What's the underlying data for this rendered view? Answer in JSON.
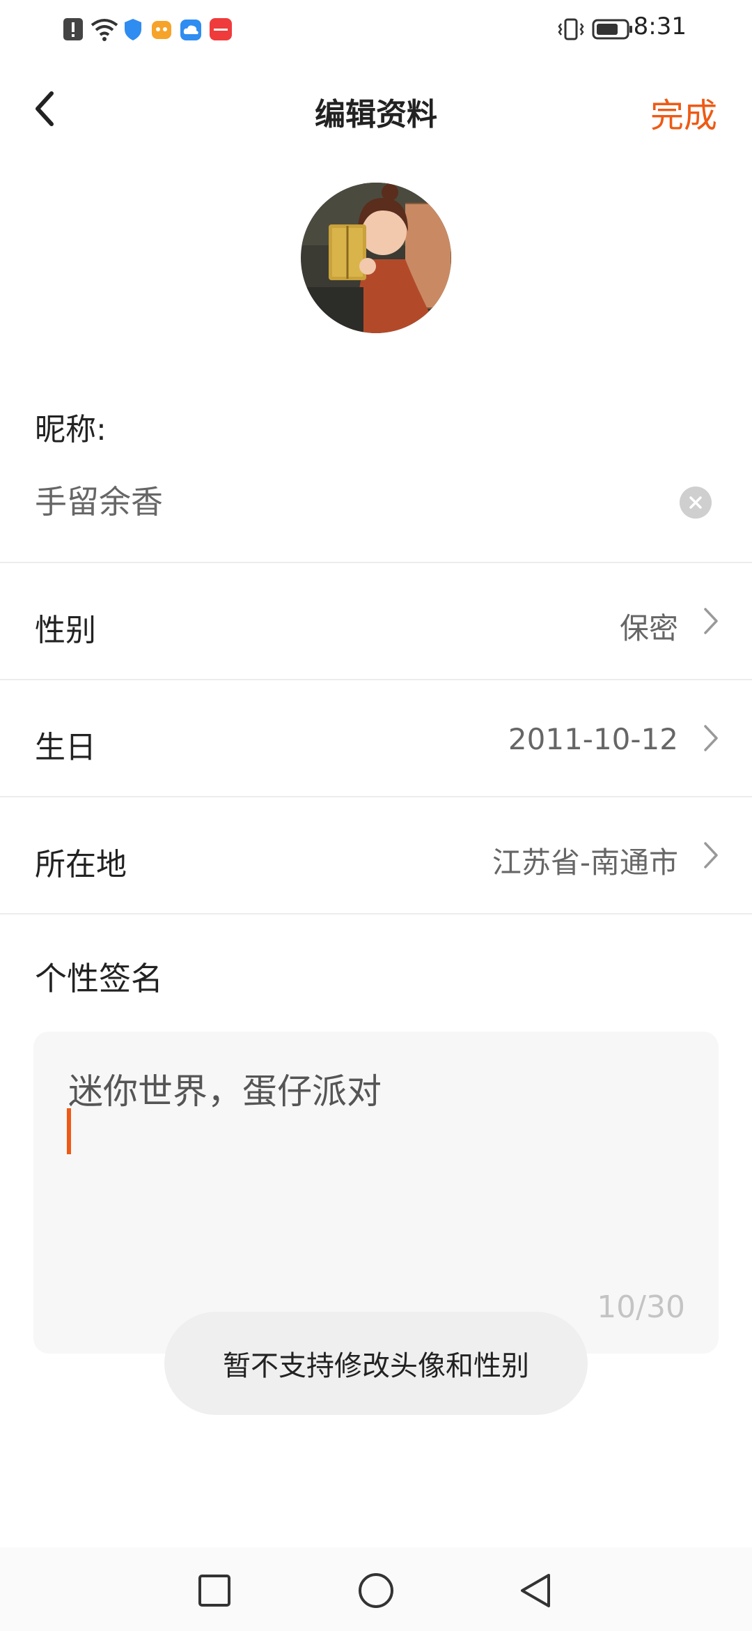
{
  "status_bar": {
    "time": "8:31",
    "icons": [
      "alert-icon",
      "wifi-icon",
      "shield-icon",
      "app-orange-icon",
      "cloud-icon",
      "huawei-store-icon",
      "vibrate-icon",
      "battery-icon"
    ]
  },
  "header": {
    "title": "编辑资料",
    "done_label": "完成"
  },
  "profile": {
    "nickname_label": "昵称:",
    "nickname_value": "手留余香",
    "rows": [
      {
        "label": "性别",
        "value": "保密"
      },
      {
        "label": "生日",
        "value": "2011-10-12"
      },
      {
        "label": "所在地",
        "value": "江苏省-南通市"
      }
    ],
    "signature_label": "个性签名",
    "signature_value": "迷你世界，蛋仔派对",
    "signature_count": "10/30"
  },
  "toast": {
    "message": "暂不支持修改头像和性别"
  },
  "colors": {
    "accent": "#ee5a14",
    "text_primary": "#222222",
    "text_secondary": "#666666",
    "divider": "#ececec"
  },
  "nav_bar": {
    "icons": [
      "recent-apps-icon",
      "home-icon",
      "back-triangle-icon"
    ]
  }
}
